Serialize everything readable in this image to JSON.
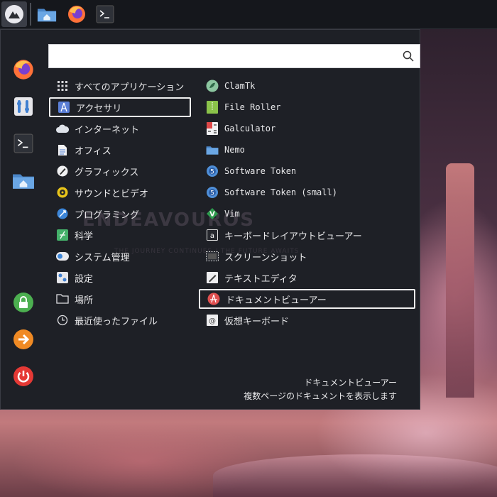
{
  "taskbar": {
    "items": [
      {
        "name": "home-folder"
      },
      {
        "name": "firefox"
      },
      {
        "name": "terminal"
      }
    ]
  },
  "search": {
    "value": "",
    "placeholder": ""
  },
  "favorites": [
    "firefox",
    "settings",
    "terminal",
    "home-folder"
  ],
  "session": [
    "lock",
    "logout",
    "power"
  ],
  "categories": [
    {
      "label": "すべてのアプリケーション",
      "icon": "grid-icon"
    },
    {
      "label": "アクセサリ",
      "icon": "accessories-icon"
    },
    {
      "label": "インターネット",
      "icon": "cloud-icon"
    },
    {
      "label": "オフィス",
      "icon": "document-icon"
    },
    {
      "label": "グラフィックス",
      "icon": "graphics-icon"
    },
    {
      "label": "サウンドとビデオ",
      "icon": "sound-icon"
    },
    {
      "label": "プログラミング",
      "icon": "programming-icon"
    },
    {
      "label": "科学",
      "icon": "science-icon"
    },
    {
      "label": "システム管理",
      "icon": "system-icon"
    },
    {
      "label": "設定",
      "icon": "settings-icon"
    },
    {
      "label": "場所",
      "icon": "folder-icon"
    },
    {
      "label": "最近使ったファイル",
      "icon": "clock-icon"
    }
  ],
  "selected_category": 1,
  "apps": [
    {
      "label": "ClamTk",
      "icon": "clamtk-icon"
    },
    {
      "label": "File Roller",
      "icon": "archive-icon"
    },
    {
      "label": "Galculator",
      "icon": "calculator-icon"
    },
    {
      "label": "Nemo",
      "icon": "nemo-folder-icon"
    },
    {
      "label": "Software Token",
      "icon": "token-icon"
    },
    {
      "label": "Software Token (small)",
      "icon": "token-icon"
    },
    {
      "label": "Vim",
      "icon": "vim-icon"
    },
    {
      "label": "キーボードレイアウトビューアー",
      "icon": "keyboard-layout-icon"
    },
    {
      "label": "スクリーンショット",
      "icon": "screenshot-icon"
    },
    {
      "label": "テキストエディタ",
      "icon": "text-editor-icon"
    },
    {
      "label": "ドキュメントビューアー",
      "icon": "document-viewer-icon"
    },
    {
      "label": "仮想キーボード",
      "icon": "virtual-keyboard-icon"
    }
  ],
  "selected_app": 10,
  "description": {
    "title": "ドキュメントビューアー",
    "text": "複数ページのドキュメントを表示します"
  },
  "watermark": {
    "main": "ENDEAVOUROS",
    "sub": "THE JOURNEY CONTINUES / THE FUTURE AWAITS"
  },
  "colors": {
    "menu_bg": "#1e2026",
    "text": "#e8e8ea",
    "lock": "#4caf50",
    "logout": "#f08a24",
    "power": "#e53935"
  }
}
